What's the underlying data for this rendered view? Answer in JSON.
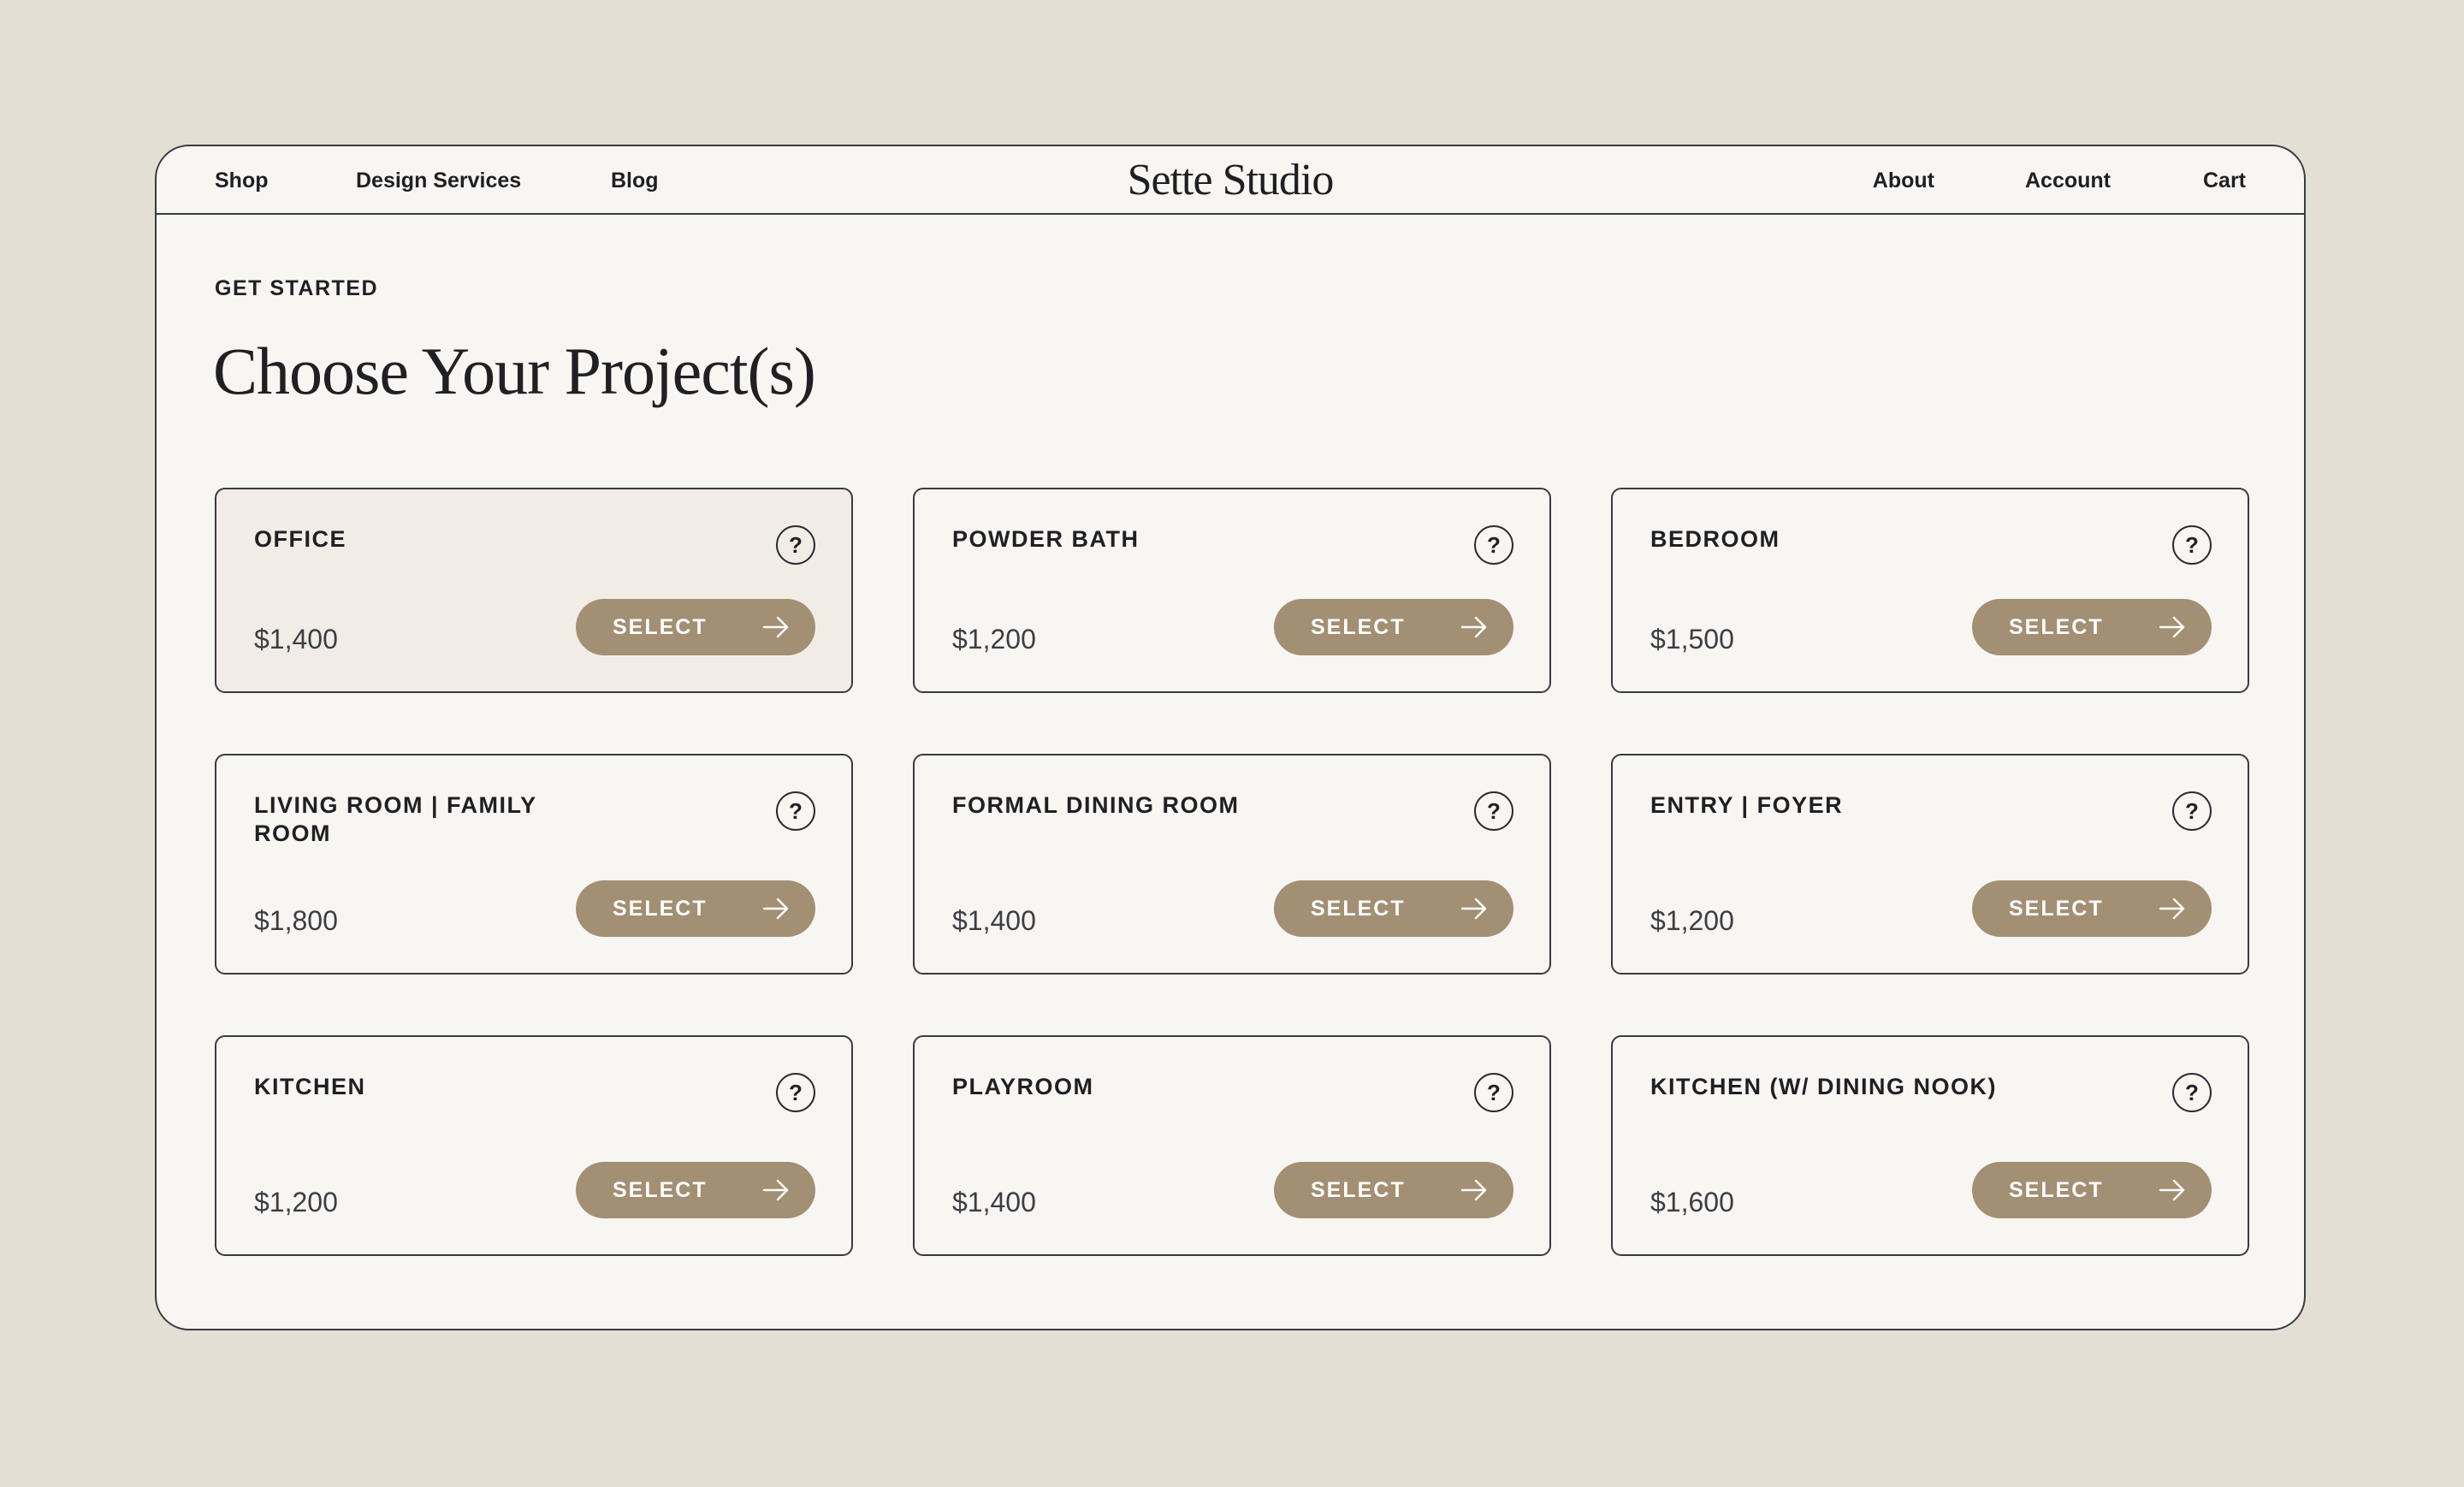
{
  "nav": {
    "left": [
      "Shop",
      "Design Services",
      "Blog"
    ],
    "brand": "Sette Studio",
    "right": [
      "About",
      "Account",
      "Cart"
    ]
  },
  "header": {
    "eyebrow": "GET STARTED",
    "title": "Choose Your Project(s)"
  },
  "theme": {
    "background": "#e3dfd4",
    "panel": "#f8f6f2",
    "selected_card": "#f1ede6",
    "accent": "#a38f73",
    "text": "#1f1f24"
  },
  "projects": [
    {
      "title": "OFFICE",
      "price": "$1,400",
      "button": "SELECT",
      "selected": true
    },
    {
      "title": "POWDER BATH",
      "price": "$1,200",
      "button": "SELECT",
      "selected": false
    },
    {
      "title": "BEDROOM",
      "price": "$1,500",
      "button": "SELECT",
      "selected": false
    },
    {
      "title": "LIVING ROOM | FAMILY ROOM",
      "price": "$1,800",
      "button": "SELECT",
      "selected": false
    },
    {
      "title": "FORMAL DINING ROOM",
      "price": "$1,400",
      "button": "SELECT",
      "selected": false
    },
    {
      "title": "ENTRY | FOYER",
      "price": "$1,200",
      "button": "SELECT",
      "selected": false
    },
    {
      "title": "KITCHEN",
      "price": "$1,200",
      "button": "SELECT",
      "selected": false
    },
    {
      "title": "PLAYROOM",
      "price": "$1,400",
      "button": "SELECT",
      "selected": false
    },
    {
      "title": "KITCHEN (W/ DINING NOOK)",
      "price": "$1,600",
      "button": "SELECT",
      "selected": false
    }
  ],
  "icons": {
    "help": "question-circle-icon",
    "help_glyph": "?",
    "arrow": "arrow-right-icon"
  }
}
